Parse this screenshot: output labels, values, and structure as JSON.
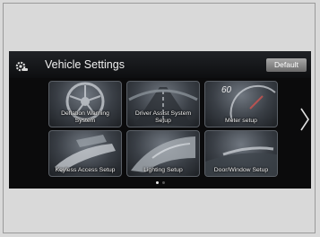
{
  "header": {
    "icon": "gear-car-icon",
    "title": "Vehicle Settings",
    "default_button": "Default"
  },
  "tiles": [
    {
      "label": "Deflation Warning System",
      "icon": "wheel-icon"
    },
    {
      "label": "Driver Assist System Setup",
      "icon": "road-icon"
    },
    {
      "label": "Meter setup",
      "icon": "speedometer-icon",
      "meter_number": "60"
    },
    {
      "label": "Keyless Access Setup",
      "icon": "key-fob-icon"
    },
    {
      "label": "Lighting Setup",
      "icon": "headlight-icon"
    },
    {
      "label": "Door/Window Setup",
      "icon": "door-icon"
    }
  ],
  "navigation": {
    "next_icon": "chevron-right-icon"
  },
  "pagination": {
    "pages": 2,
    "current": 1
  }
}
